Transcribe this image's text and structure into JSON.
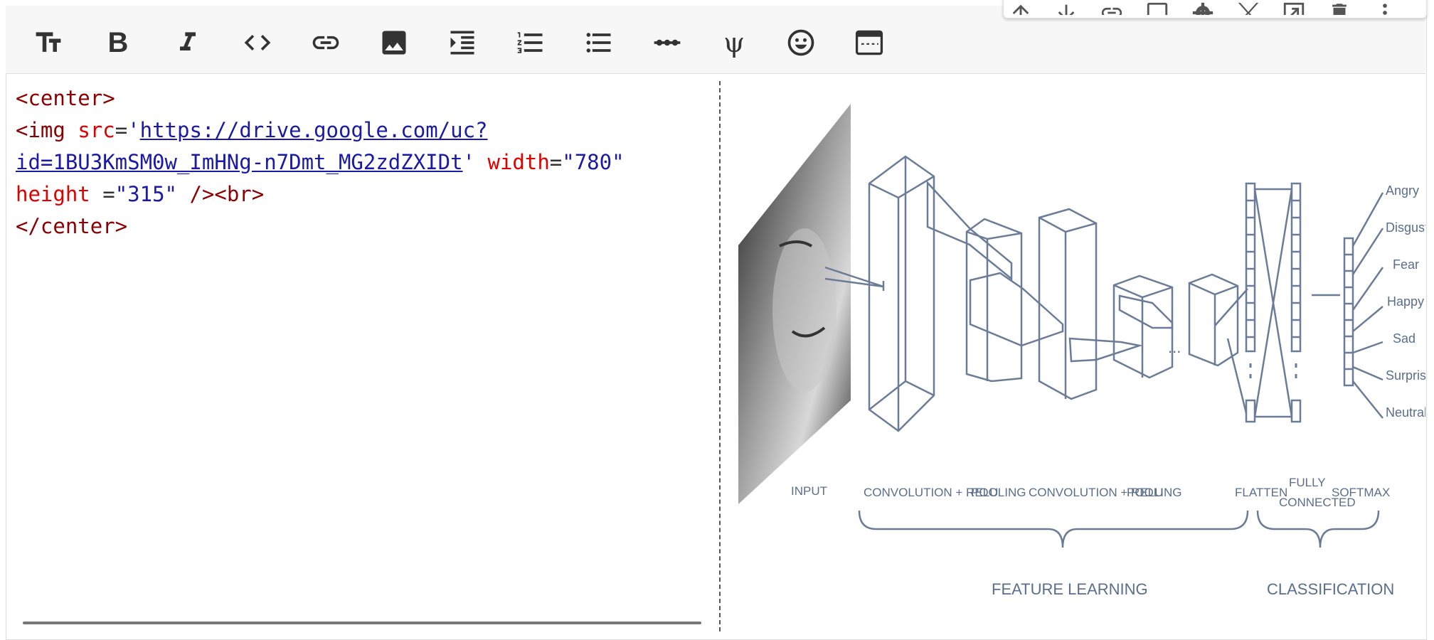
{
  "toolbar": {
    "buttons": [
      {
        "name": "text-size",
        "icon": "text-size-icon"
      },
      {
        "name": "bold",
        "icon": "bold-icon",
        "label": "B"
      },
      {
        "name": "italic",
        "icon": "italic-icon",
        "label": "I"
      },
      {
        "name": "code",
        "icon": "code-icon"
      },
      {
        "name": "link",
        "icon": "link-icon"
      },
      {
        "name": "image",
        "icon": "image-icon"
      },
      {
        "name": "indent",
        "icon": "indent-icon"
      },
      {
        "name": "numbered-list",
        "icon": "numbered-list-icon"
      },
      {
        "name": "bulleted-list",
        "icon": "bulleted-list-icon"
      },
      {
        "name": "horizontal-rule",
        "icon": "horizontal-rule-icon"
      },
      {
        "name": "latex",
        "icon": "psi-icon",
        "label": "ψ"
      },
      {
        "name": "emoji",
        "icon": "emoji-icon"
      },
      {
        "name": "preview-mode",
        "icon": "window-icon"
      }
    ]
  },
  "cell_toolbar": {
    "icons": [
      "arrow-up-icon",
      "arrow-down-icon",
      "link-icon",
      "comment-icon",
      "gear-icon",
      "scissors-icon",
      "open-in-window-icon",
      "delete-icon",
      "more-vert-icon"
    ]
  },
  "editor": {
    "line1_tag": "<center>",
    "line2_open": "<img ",
    "line2_attr_src": "src",
    "line2_eq": "=",
    "line2_quote_open": "'",
    "line2_url_part1": "https://drive.google.com/uc?",
    "line3_url_part2": "id=1BU3KmSM0w_ImHNg-n7Dmt_MG2zdZXIDt",
    "line3_quote_close": "'",
    "line3_attr_width": "width",
    "line3_eq": "=",
    "line3_width_value": "\"780\"",
    "line4_attr_height": "height",
    "line4_eq": " =",
    "line4_height_value": "\"315\"",
    "line4_close": " /><br>",
    "line5_tag": "</center>"
  },
  "preview": {
    "labels": {
      "input": "INPUT",
      "conv1": "CONVOLUTION + RELU",
      "pool1": "POOLING",
      "conv2": "CONVOLUTION + RELU",
      "pool2": "POOLING",
      "flatten": "FLATTEN",
      "fully_1": "FULLY",
      "fully_2": "CONNECTED",
      "softmax": "SOFTMAX",
      "feature_learning": "FEATURE LEARNING",
      "classification": "CLASSIFICATION",
      "dots": "...",
      "outputs": [
        "Angry",
        "Disgust",
        "Fear",
        "Happy",
        "Sad",
        "Surprise",
        "Neutral"
      ]
    },
    "colors": {
      "diagram_line": "#6b7c98",
      "diagram_text": "#5b6e8c"
    }
  }
}
